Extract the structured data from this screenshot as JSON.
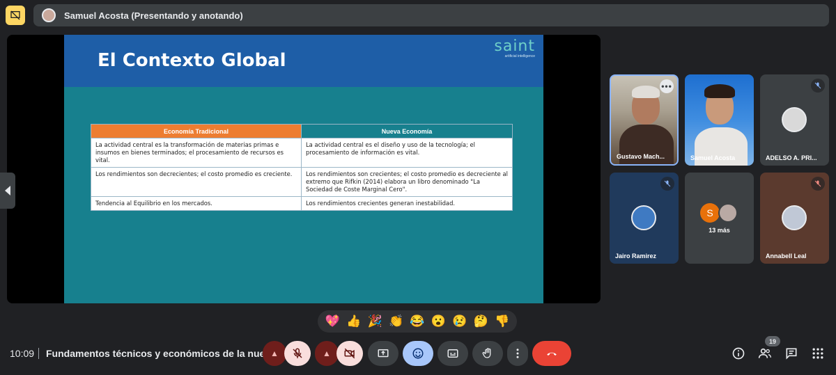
{
  "top_bar": {
    "presenter_banner": "Samuel Acosta (Presentando y anotando)"
  },
  "slide": {
    "title": "El Contexto Global",
    "logo_text": "saint",
    "logo_subtitle": "artificial intelligence",
    "table": {
      "headers": [
        "Economía Tradicional",
        "Nueva Economía"
      ],
      "rows": [
        [
          "La actividad central es la transformación de materias primas e insumos en bienes terminados; el procesamiento de recursos es vital.",
          "La actividad central es el diseño y uso de la tecnología; el procesamiento de información es vital."
        ],
        [
          "Los rendimientos son decrecientes; el costo promedio es creciente.",
          "Los rendimientos son crecientes; el costo promedio es decreciente al extremo que Rifkin (2014) elabora un libro denominado \"La Sociedad de Coste Marginal Cero\"."
        ],
        [
          "Tendencia al Equilibrio en los mercados.",
          "Los rendimientos crecientes generan inestabilidad."
        ]
      ]
    }
  },
  "participants": [
    {
      "name": "Gustavo Mach...",
      "muted": false,
      "speaking": true
    },
    {
      "name": "Samuel Acosta",
      "muted": false
    },
    {
      "name": "ADELSO A. PRI...",
      "muted": true
    },
    {
      "name": "Jairo Ramirez",
      "muted": true
    },
    {
      "initial": "S",
      "more_label": "13 más"
    },
    {
      "name": "Annabell Leal",
      "muted": true
    }
  ],
  "reactions": [
    "💖",
    "👍",
    "🎉",
    "👏",
    "😂",
    "😮",
    "😢",
    "🤔",
    "👎"
  ],
  "bottom_bar": {
    "time": "10:09",
    "meeting_title": "Fundamentos técnicos y económicos de la nuev...",
    "people_count": "19"
  },
  "colors": {
    "slide_header": "#1e5ea7",
    "slide_body": "#17808e",
    "table_header_left": "#ed7d31",
    "hangup": "#ea4335",
    "presenting_icon": "#fdd663"
  },
  "icons": [
    "present-off-icon",
    "mic-off-icon",
    "camera-off-icon",
    "present-screen-icon",
    "emoji-icon",
    "captions-icon",
    "raise-hand-icon",
    "more-options-icon",
    "hangup-icon",
    "info-icon",
    "people-icon",
    "chat-icon",
    "activities-icon"
  ]
}
